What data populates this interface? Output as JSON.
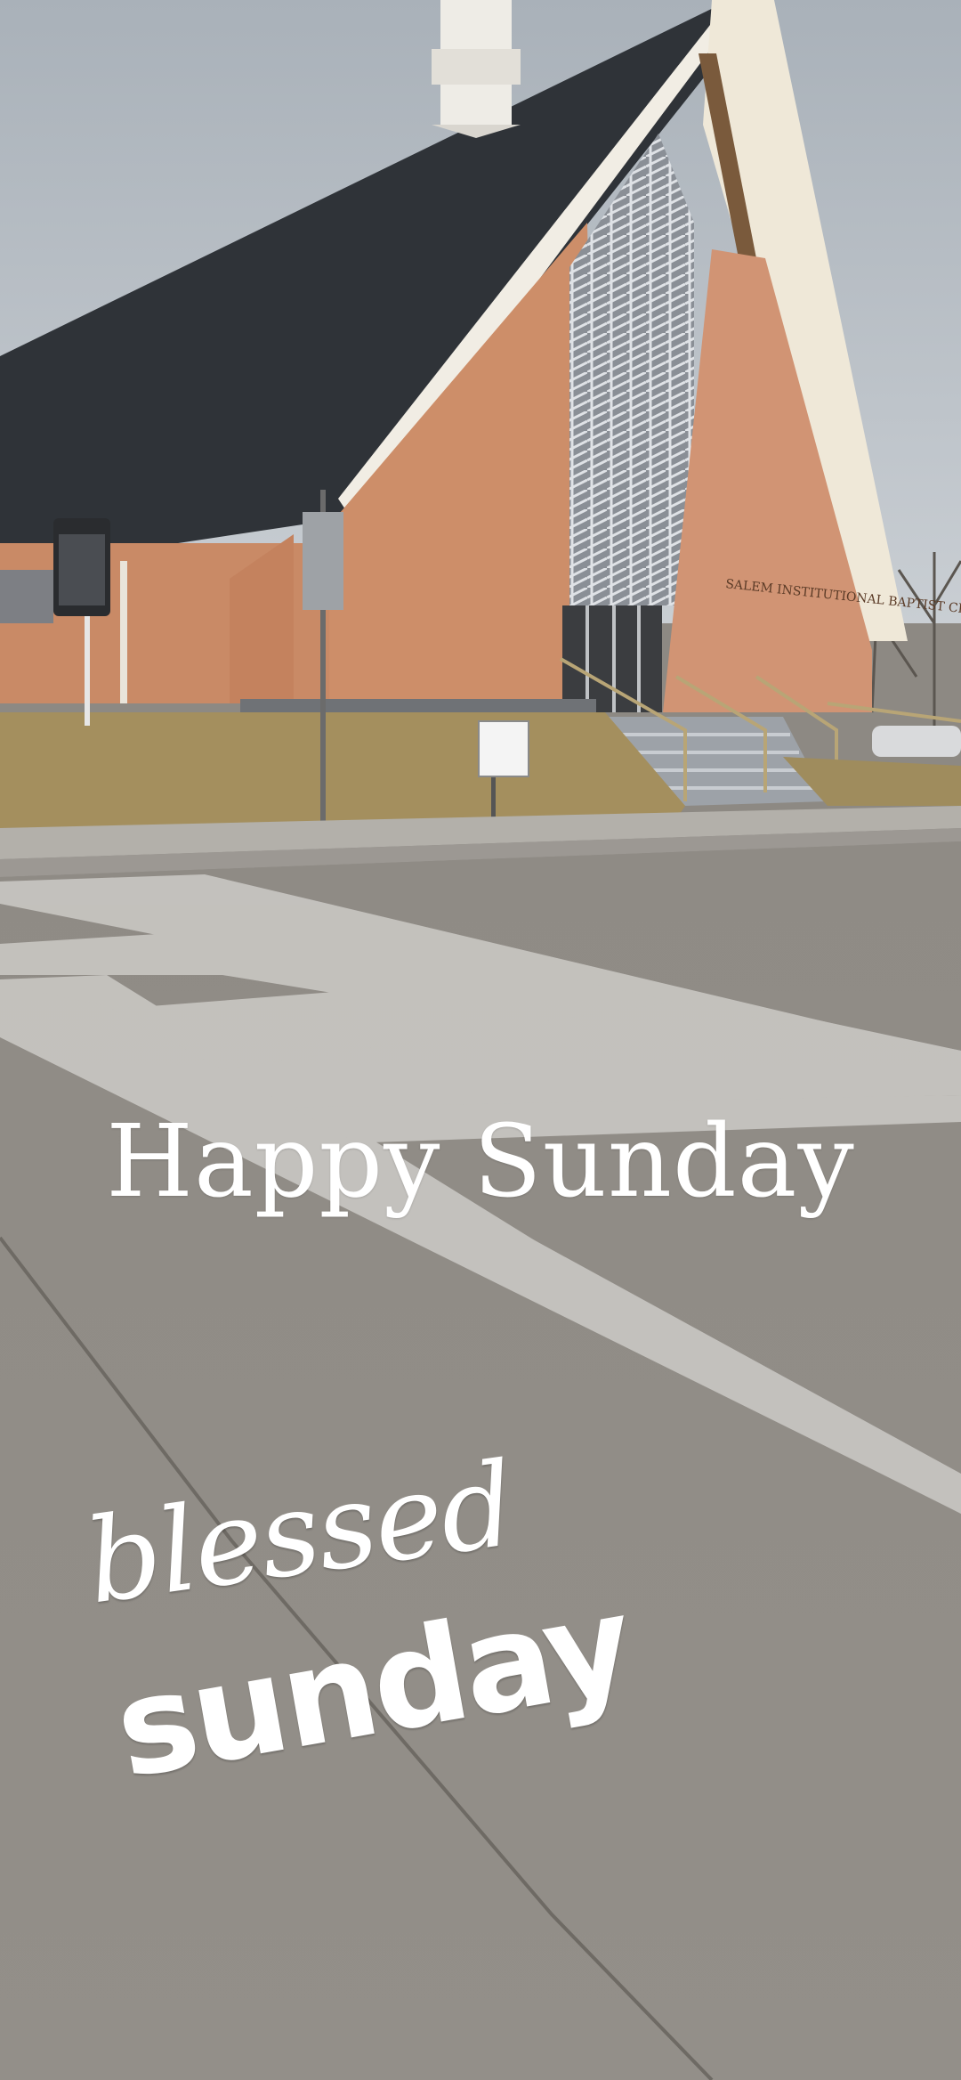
{
  "overlay": {
    "title": "Happy Sunday"
  },
  "sticker": {
    "line1": "blessed",
    "line2": "sunday"
  },
  "sign": {
    "church_name": "SALEM INSTITUTIONAL BAPTIST CHURCH"
  },
  "colors": {
    "sky": "#b9c0c7",
    "roof": "#2f3338",
    "brick": "#c98a66",
    "trim": "#f2efe8",
    "road": "#8e8a84",
    "crosswalk": "#c9c7c3",
    "grass": "#a48f5e"
  }
}
